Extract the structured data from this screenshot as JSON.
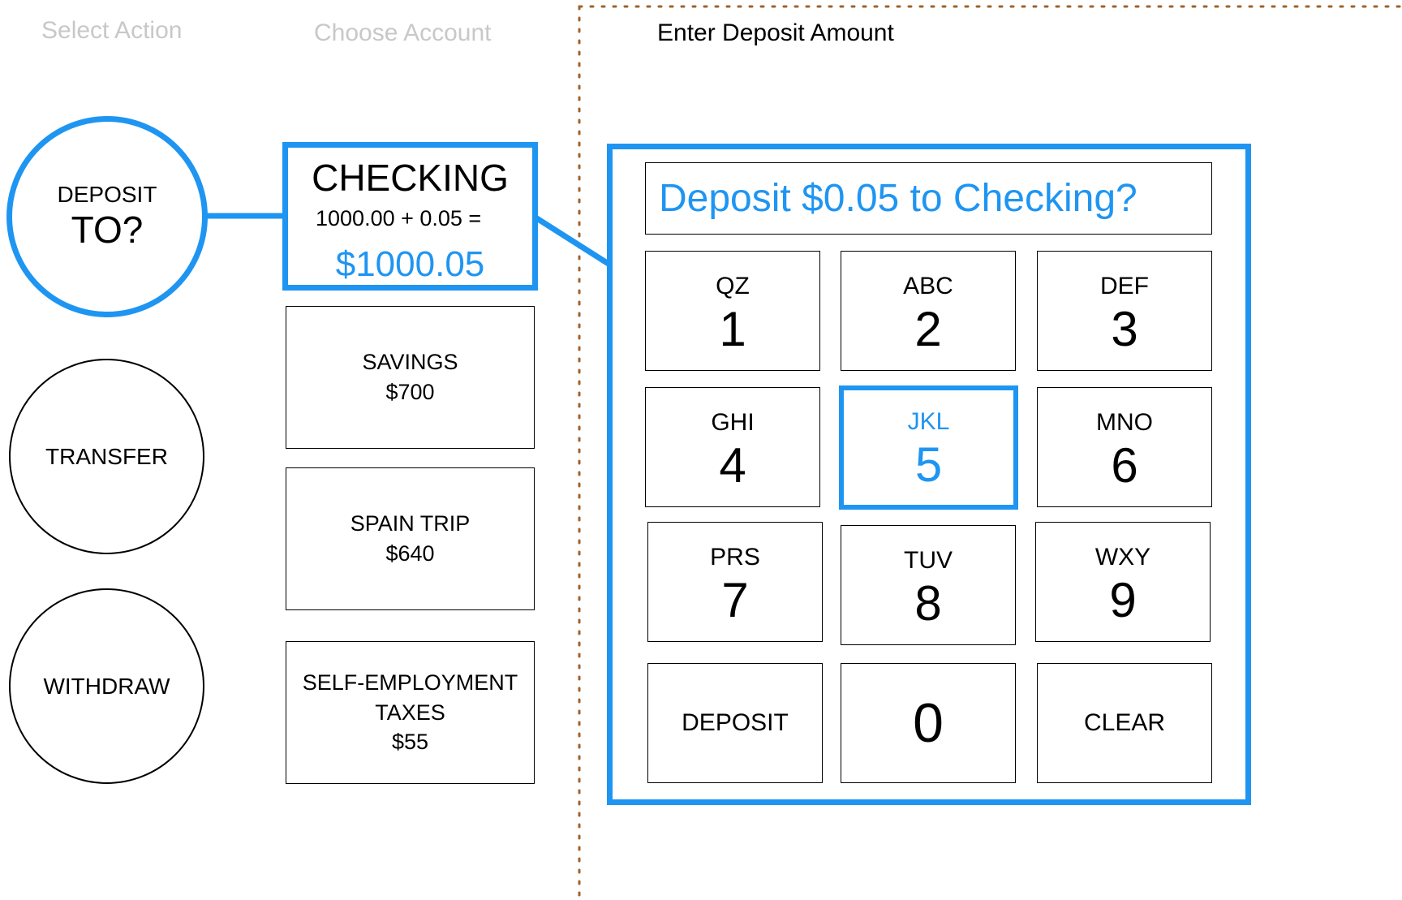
{
  "steps": {
    "select_action": "Select Action",
    "choose_account": "Choose Account",
    "enter_amount": "Enter Deposit Amount"
  },
  "actions": {
    "deposit": {
      "line1": "DEPOSIT",
      "line2": "TO?"
    },
    "transfer": "TRANSFER",
    "withdraw": "WITHDRAW"
  },
  "accounts": {
    "checking": {
      "name": "CHECKING",
      "calc": "1000.00 + 0.05 =",
      "total": "$1000.05"
    },
    "savings": {
      "name": "SAVINGS",
      "balance": "$700"
    },
    "spain_trip": {
      "name": "SPAIN TRIP",
      "balance": "$640"
    },
    "self_employment": {
      "name_line1": "SELF-EMPLOYMENT",
      "name_line2": "TAXES",
      "balance": "$55"
    }
  },
  "keypad": {
    "prompt": "Deposit $0.05 to Checking?",
    "keys": [
      {
        "letters": "QZ",
        "digit": "1"
      },
      {
        "letters": "ABC",
        "digit": "2"
      },
      {
        "letters": "DEF",
        "digit": "3"
      },
      {
        "letters": "GHI",
        "digit": "4"
      },
      {
        "letters": "JKL",
        "digit": "5"
      },
      {
        "letters": "MNO",
        "digit": "6"
      },
      {
        "letters": "PRS",
        "digit": "7"
      },
      {
        "letters": "TUV",
        "digit": "8"
      },
      {
        "letters": "WXY",
        "digit": "9"
      }
    ],
    "deposit_label": "DEPOSIT",
    "zero": "0",
    "clear_label": "CLEAR"
  },
  "colors": {
    "accent": "#1f95f2",
    "divider": "#a0622d",
    "muted_text": "#c8c8c8"
  }
}
